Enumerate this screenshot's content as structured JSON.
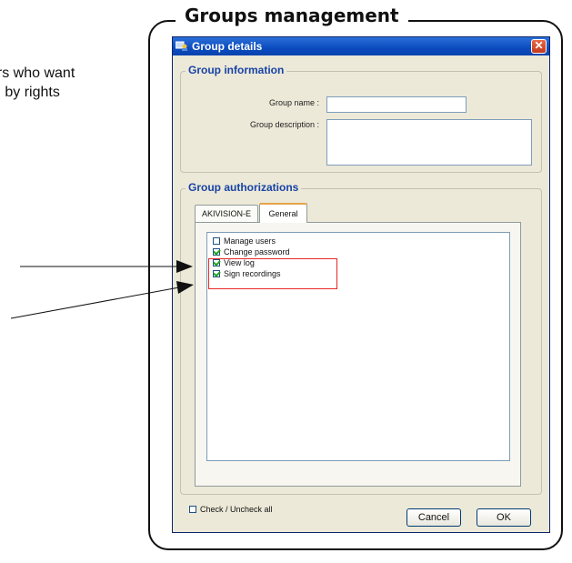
{
  "side_text": {
    "line1": "sers who want",
    "line2": "d by rights"
  },
  "frame": {
    "title": "Groups management"
  },
  "dialog": {
    "title": "Group details",
    "group_information": {
      "legend": "Group information",
      "group_name_label": "Group name :",
      "group_name_value": "",
      "group_description_label": "Group description :",
      "group_description_value": ""
    },
    "group_authorizations": {
      "legend": "Group authorizations",
      "tabs": [
        {
          "label": "AKIVISION-E",
          "active": false
        },
        {
          "label": "General",
          "active": true
        }
      ],
      "permissions": [
        {
          "label": "Manage users",
          "checked": false
        },
        {
          "label": "Change password",
          "checked": true
        },
        {
          "label": "View log",
          "checked": true
        },
        {
          "label": "Sign recordings",
          "checked": true
        }
      ],
      "check_all_label": "Check / Uncheck all",
      "check_all_checked": false
    },
    "buttons": {
      "cancel": "Cancel",
      "ok": "OK"
    }
  },
  "colors": {
    "titlebar": "#0b4bbf",
    "legend": "#1843a6",
    "highlight": "#e82727",
    "dialog_bg": "#ece9d8"
  },
  "icons": [
    "group-details-icon",
    "close-icon",
    "arrow-icon"
  ]
}
